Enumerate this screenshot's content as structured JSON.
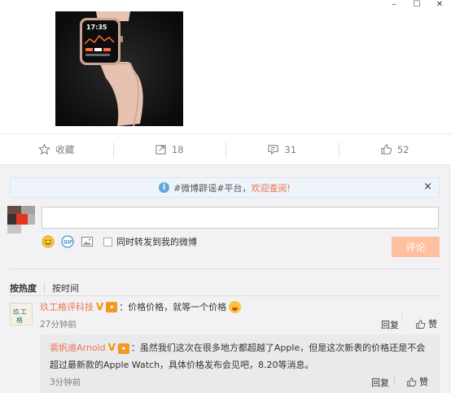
{
  "window": {
    "minimize": "–",
    "maximize": "☐",
    "close": "✕"
  },
  "actions": {
    "favorite_label": "收藏",
    "repost_count": "18",
    "comment_count": "31",
    "like_count": "52"
  },
  "notice": {
    "prefix": "#微博辟谣#平台，",
    "highlight": "欢迎查阅!",
    "close": "×"
  },
  "composer": {
    "input_value": "",
    "repost_checkbox_label": "同时转发到我的微博",
    "submit_label": "评论"
  },
  "sort": {
    "hot": "按热度",
    "time": "按时间"
  },
  "comments": [
    {
      "user": "玖工格评科技",
      "verified": "V",
      "separator": "：",
      "text": "价格价格，就等一个价格",
      "time": "27分钟前",
      "reply_label": "回复",
      "like_label": "赞",
      "replies": [
        {
          "user": "裴帆迪Arnold",
          "verified": "V",
          "separator": "：",
          "text": "虽然我们这次在很多地方都超越了Apple，但是这次新表的价格还是不会超过最新款的Apple Watch，具体价格发布会见吧，8.20等消息。",
          "time": "3分钟前",
          "reply_label": "回复",
          "like_label": "赞"
        }
      ]
    }
  ],
  "colors": {
    "accent": "#eb7350",
    "submit_bg": "#ffc09f",
    "verified": "#f39200",
    "info": "#5fa6d9"
  }
}
